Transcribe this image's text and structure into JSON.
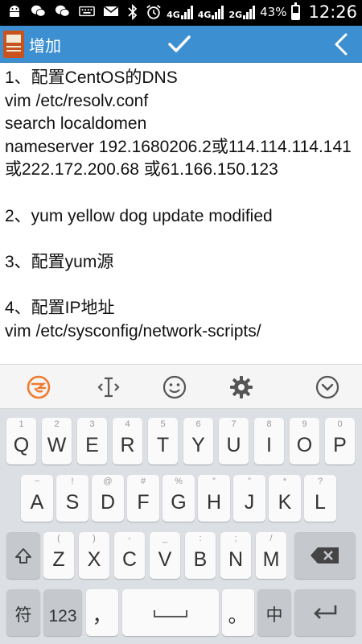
{
  "status_bar": {
    "network_left": "4G",
    "network_a": "4G",
    "network_b": "2G",
    "battery_percent": "43%",
    "time": "12:26",
    "icons": [
      "android-icon",
      "wechat-icon",
      "wechat-icon",
      "keyboard-icon",
      "mail-icon",
      "bluetooth-icon",
      "alarm-icon"
    ]
  },
  "app_bar": {
    "title": "增加",
    "icons": [
      "notebook-app-icon",
      "check-icon",
      "back-chevron-icon"
    ]
  },
  "note": {
    "content": "1、配置CentOS的DNS\nvim /etc/resolv.conf\nsearch localdomen\nnameserver 192.1680206.2或114.114.114.141 或222.172.200.68 或61.166.150.123\n\n2、yum yellow dog update modified\n\n3、配置yum源\n\n4、配置IP地址\nvim /etc/sysconfig/network-scripts/"
  },
  "ime_toolbar": {
    "tools": [
      "ime-logo-icon",
      "cursor-icon",
      "emoji-icon",
      "settings-icon",
      "collapse-keyboard-icon"
    ]
  },
  "keyboard": {
    "row1": [
      {
        "label": "Q",
        "hint": "1"
      },
      {
        "label": "W",
        "hint": "2"
      },
      {
        "label": "E",
        "hint": "3"
      },
      {
        "label": "R",
        "hint": "4"
      },
      {
        "label": "T",
        "hint": "5"
      },
      {
        "label": "Y",
        "hint": "6"
      },
      {
        "label": "U",
        "hint": "7"
      },
      {
        "label": "I",
        "hint": "8"
      },
      {
        "label": "O",
        "hint": "9"
      },
      {
        "label": "P",
        "hint": "0"
      }
    ],
    "row2": [
      {
        "label": "A",
        "hint": "~"
      },
      {
        "label": "S",
        "hint": "!"
      },
      {
        "label": "D",
        "hint": "@"
      },
      {
        "label": "F",
        "hint": "#"
      },
      {
        "label": "G",
        "hint": "%"
      },
      {
        "label": "H",
        "hint": "”"
      },
      {
        "label": "J",
        "hint": "”"
      },
      {
        "label": "K",
        "hint": "*"
      },
      {
        "label": "L",
        "hint": "?"
      }
    ],
    "row3": [
      {
        "label": "Z",
        "hint": "("
      },
      {
        "label": "X",
        "hint": ")"
      },
      {
        "label": "C",
        "hint": "-"
      },
      {
        "label": "V",
        "hint": "_"
      },
      {
        "label": "B",
        "hint": ":"
      },
      {
        "label": "N",
        "hint": ";"
      },
      {
        "label": "M",
        "hint": "/"
      }
    ],
    "symbol_key": "符",
    "number_key": "123",
    "comma_key": "，",
    "period_key": "。",
    "lang_key": "中",
    "special_icons": [
      "shift-icon",
      "backspace-icon",
      "space-icon",
      "enter-icon"
    ]
  }
}
